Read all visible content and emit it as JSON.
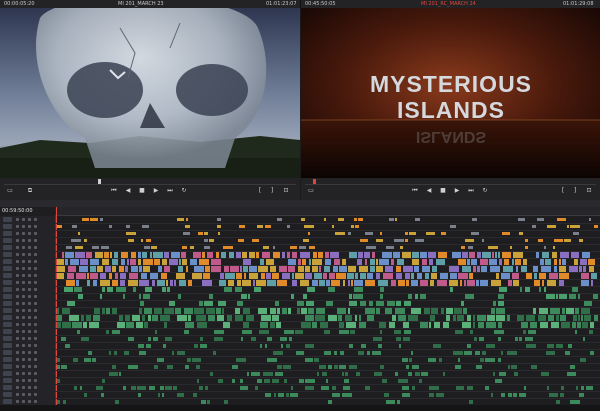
{
  "header": {
    "left_timecode": "00:00:05:20",
    "left_clip": "MI 201_MARCH 23",
    "left_duration": "01:01:23:07",
    "right_timecode": "00:45:50:05",
    "right_clip": "MI 201_RC_MARCH 24",
    "right_duration": "01:01:29:08"
  },
  "viewer_right": {
    "title_line1": "MYSTERIOUS",
    "title_line2": "ISLANDS"
  },
  "timeline": {
    "timecode": "00:59:50:00"
  },
  "colors": {
    "accent": "#e0463d",
    "audio_clip": "#3c8a5c",
    "video_clip": "#6b8fc9"
  },
  "icons": [
    "play-icon",
    "stop-icon",
    "rewind-icon",
    "fast-forward-icon",
    "loop-icon",
    "prev-icon",
    "next-icon"
  ]
}
